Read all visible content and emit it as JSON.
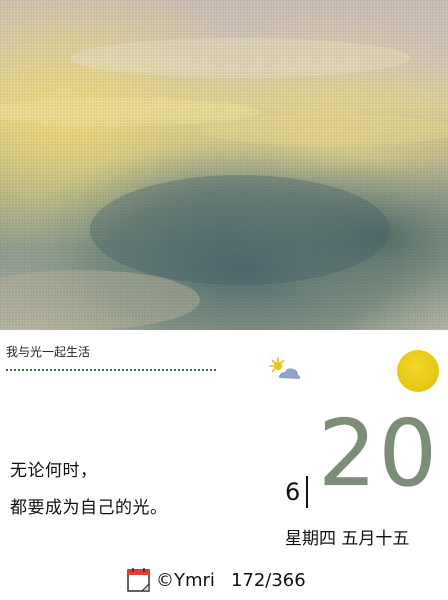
{
  "caption": "我与光一起生活",
  "quote": {
    "line1": "无论何时，",
    "line2": "都要成为自己的光。"
  },
  "date": {
    "month": "6",
    "day": "20",
    "weekday_lunar": "星期四 五月十五"
  },
  "footer": {
    "author": "©Ymri",
    "day_count": "172/366"
  },
  "icons": {
    "weather": "partly-sunny-icon",
    "sun": "sun-circle-icon",
    "calendar": "calendar-icon"
  },
  "colors": {
    "sun_yellow": "#e6c514",
    "day_number": "#7d8d78",
    "rule_green": "#3f6b3a"
  }
}
